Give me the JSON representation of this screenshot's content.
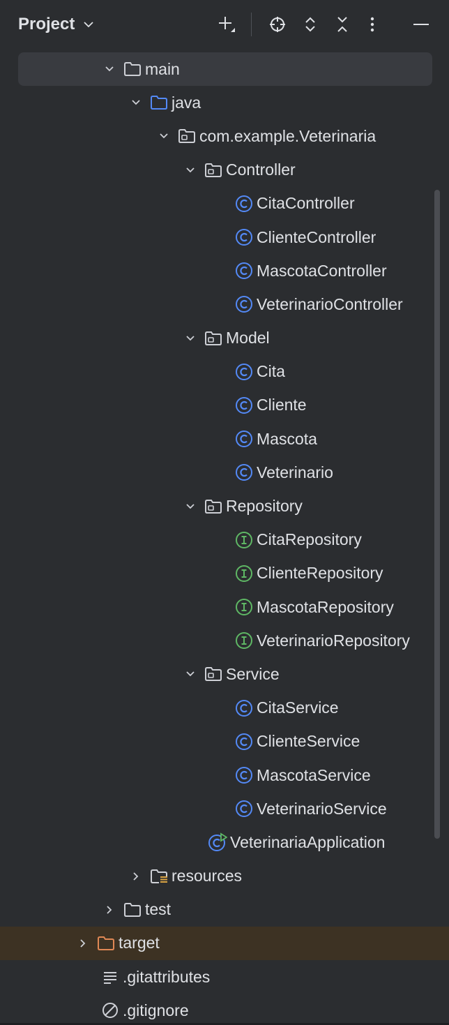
{
  "panel": {
    "title": "Project",
    "toolbar": [
      "plus-icon",
      "locate-icon",
      "expand-all-icon",
      "collapse-all-icon",
      "more-icon",
      "minimize-icon"
    ]
  },
  "colors": {
    "background": "#2b2d30",
    "selected_row": "#393b40",
    "highlight_row": "#3d3223",
    "class_icon": "#548af7",
    "interface_icon": "#5fb865",
    "folder_blue": "#548af7",
    "folder_orange": "#e08855",
    "text": "#dfe1e5"
  },
  "tree": {
    "nodes": [
      {
        "label": "main",
        "icon": "folder-icon",
        "expanded": true
      },
      {
        "label": "java",
        "icon": "source-folder-icon",
        "expanded": true
      },
      {
        "label": "com.example.Veterinaria",
        "icon": "package-icon",
        "expanded": true
      },
      {
        "label": "Controller",
        "icon": "package-icon",
        "expanded": true
      },
      {
        "label": "CitaController",
        "icon": "class-icon"
      },
      {
        "label": "ClienteController",
        "icon": "class-icon"
      },
      {
        "label": "MascotaController",
        "icon": "class-icon"
      },
      {
        "label": "VeterinarioController",
        "icon": "class-icon"
      },
      {
        "label": "Model",
        "icon": "package-icon",
        "expanded": true
      },
      {
        "label": "Cita",
        "icon": "class-icon"
      },
      {
        "label": "Cliente",
        "icon": "class-icon"
      },
      {
        "label": "Mascota",
        "icon": "class-icon"
      },
      {
        "label": "Veterinario",
        "icon": "class-icon"
      },
      {
        "label": "Repository",
        "icon": "package-icon",
        "expanded": true
      },
      {
        "label": "CitaRepository",
        "icon": "interface-icon"
      },
      {
        "label": "ClienteRepository",
        "icon": "interface-icon"
      },
      {
        "label": "MascotaRepository",
        "icon": "interface-icon"
      },
      {
        "label": "VeterinarioRepository",
        "icon": "interface-icon"
      },
      {
        "label": "Service",
        "icon": "package-icon",
        "expanded": true
      },
      {
        "label": "CitaService",
        "icon": "class-icon"
      },
      {
        "label": "ClienteService",
        "icon": "class-icon"
      },
      {
        "label": "MascotaService",
        "icon": "class-icon"
      },
      {
        "label": "VeterinarioService",
        "icon": "class-icon"
      },
      {
        "label": "VeterinariaApplication",
        "icon": "spring-boot-class-icon"
      },
      {
        "label": "resources",
        "icon": "resources-folder-icon",
        "expanded": false
      },
      {
        "label": "test",
        "icon": "folder-icon",
        "expanded": false
      },
      {
        "label": "target",
        "icon": "excluded-folder-icon",
        "expanded": false
      },
      {
        "label": ".gitattributes",
        "icon": "text-file-icon"
      },
      {
        "label": ".gitignore",
        "icon": "ignore-file-icon"
      }
    ]
  }
}
